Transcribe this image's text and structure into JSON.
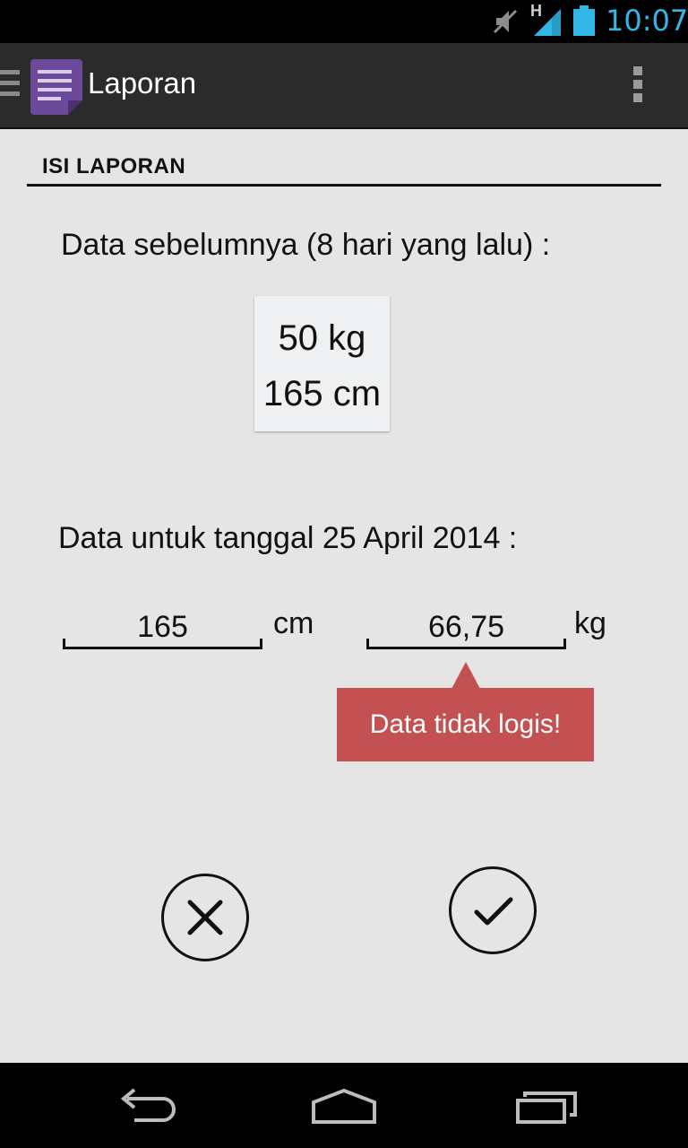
{
  "status_bar": {
    "clock": "10:07",
    "network_type": "H",
    "icons": [
      "mute-icon",
      "signal-icon",
      "battery-icon"
    ],
    "accent_color": "#33b5e5"
  },
  "action_bar": {
    "title": "Laporan",
    "app_icon": "report-icon",
    "app_icon_color": "#6a4a99"
  },
  "form": {
    "section_title": "ISI LAPORAN",
    "previous": {
      "label": "Data sebelumnya (8 hari yang lalu) :",
      "weight": "50 kg",
      "height": "165 cm"
    },
    "current": {
      "label": "Data untuk tanggal 25 April 2014 :",
      "height_value": "165",
      "height_unit": "cm",
      "weight_value": "66,75",
      "weight_unit": "kg"
    },
    "error_tooltip": "Data tidak logis!",
    "error_color": "#c45151",
    "cancel_icon": "close-icon",
    "confirm_icon": "check-icon"
  },
  "nav_bar": {
    "icons": [
      "back-icon",
      "home-icon",
      "recent-apps-icon"
    ]
  }
}
